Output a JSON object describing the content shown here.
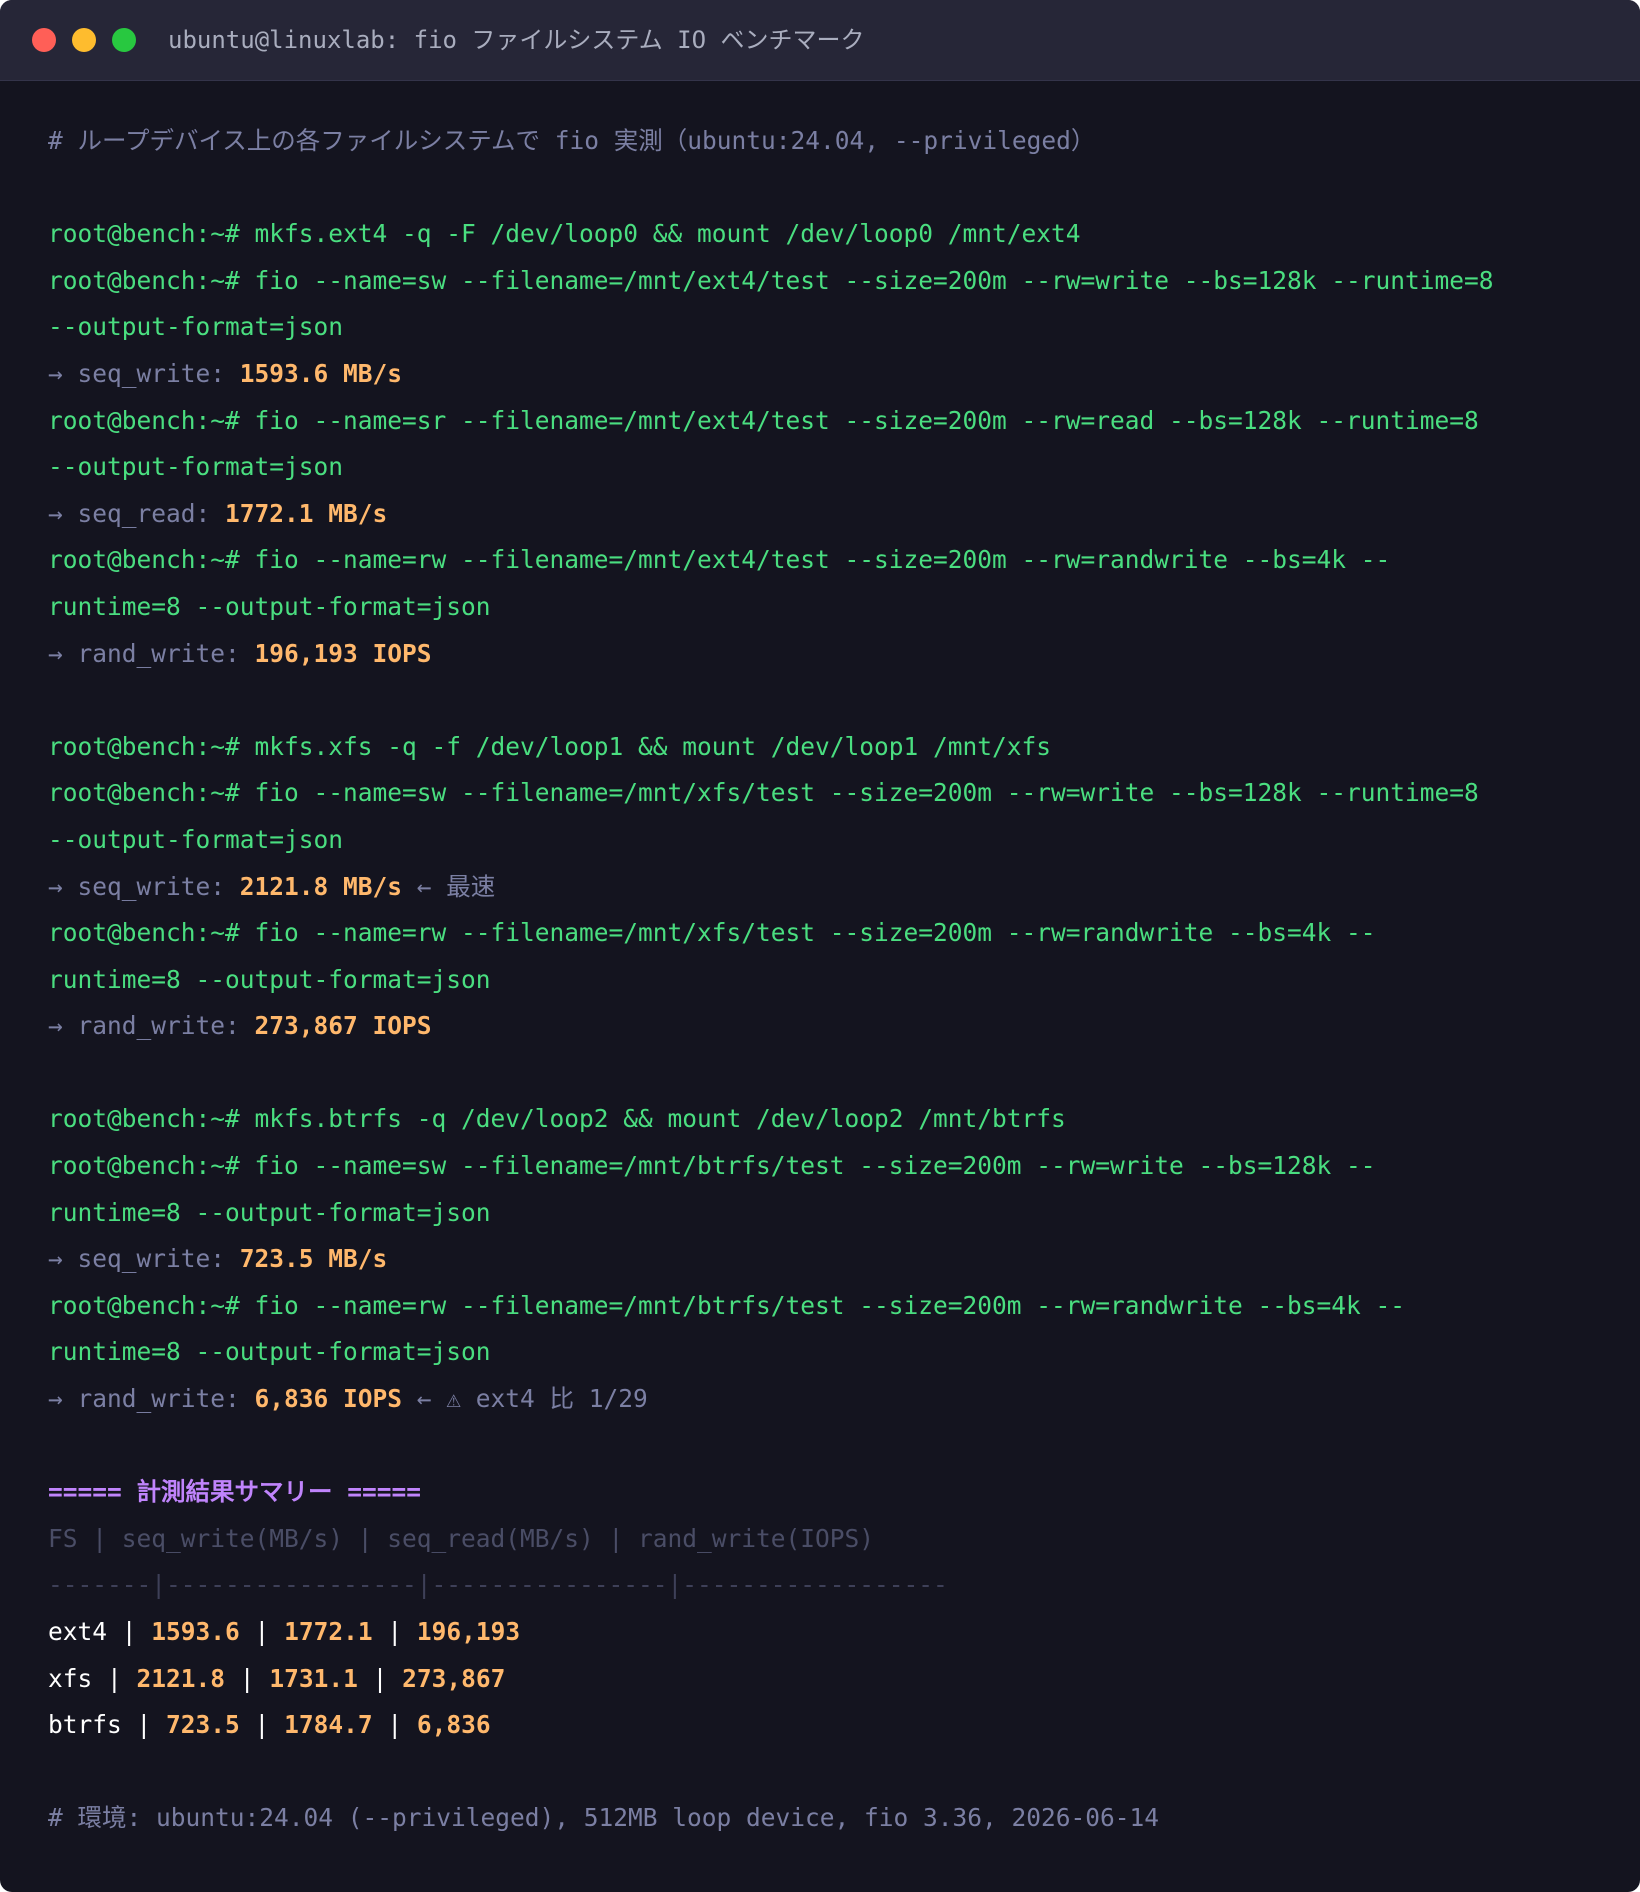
{
  "window": {
    "title": "ubuntu@linuxlab: fio ファイルシステム IO ベンチマーク"
  },
  "colors": {
    "background": "#14141f",
    "command": "#4ade80",
    "value": "#ffb86c",
    "comment": "#7b7fa3",
    "heading": "#c084fc"
  },
  "terminal": {
    "intro_comment": "# ループデバイス上の各ファイルシステムで fio 実測（ubuntu:24.04, --privileged）",
    "ext4": {
      "mkfs": "root@bench:~# mkfs.ext4 -q -F /dev/loop0 && mount /dev/loop0 /mnt/ext4",
      "sw_cmd_1": "root@bench:~# fio --name=sw --filename=/mnt/ext4/test --size=200m --rw=write --bs=128k --runtime=8",
      "sw_cmd_2": "--output-format=json",
      "sw_label": "→ seq_write: ",
      "sw_value": "1593.6 MB/s",
      "sr_cmd_1": "root@bench:~# fio --name=sr --filename=/mnt/ext4/test --size=200m --rw=read --bs=128k --runtime=8",
      "sr_cmd_2": "--output-format=json",
      "sr_label": "→ seq_read: ",
      "sr_value": "1772.1 MB/s",
      "rw_cmd_1": "root@bench:~# fio --name=rw --filename=/mnt/ext4/test --size=200m --rw=randwrite --bs=4k --",
      "rw_cmd_2": "runtime=8 --output-format=json",
      "rw_label": "→ rand_write: ",
      "rw_value": "196,193 IOPS"
    },
    "xfs": {
      "mkfs": "root@bench:~# mkfs.xfs -q -f /dev/loop1 && mount /dev/loop1 /mnt/xfs",
      "sw_cmd_1": "root@bench:~# fio --name=sw --filename=/mnt/xfs/test --size=200m --rw=write --bs=128k --runtime=8",
      "sw_cmd_2": "--output-format=json",
      "sw_label": "→ seq_write: ",
      "sw_value": "2121.8 MB/s",
      "sw_note": " ← 最速",
      "rw_cmd_1": "root@bench:~# fio --name=rw --filename=/mnt/xfs/test --size=200m --rw=randwrite --bs=4k --",
      "rw_cmd_2": "runtime=8 --output-format=json",
      "rw_label": "→ rand_write: ",
      "rw_value": "273,867 IOPS"
    },
    "btrfs": {
      "mkfs": "root@bench:~# mkfs.btrfs -q /dev/loop2 && mount /dev/loop2 /mnt/btrfs",
      "sw_cmd_1": "root@bench:~# fio --name=sw --filename=/mnt/btrfs/test --size=200m --rw=write --bs=128k --",
      "sw_cmd_2": "runtime=8 --output-format=json",
      "sw_label": "→ seq_write: ",
      "sw_value": "723.5 MB/s",
      "rw_cmd_1": "root@bench:~# fio --name=rw --filename=/mnt/btrfs/test --size=200m --rw=randwrite --bs=4k --",
      "rw_cmd_2": "runtime=8 --output-format=json",
      "rw_label": "→ rand_write: ",
      "rw_value": "6,836 IOPS",
      "rw_note": " ← ⚠ ext4 比 1/29"
    },
    "summary": {
      "heading": "===== 計測結果サマリー =====",
      "columns": "FS | seq_write(MB/s) | seq_read(MB/s) | rand_write(IOPS)",
      "separator": "-------|-----------------|----------------|------------------",
      "rows": [
        {
          "fs": "ext4",
          "seq_write": "1593.6",
          "seq_read": "1772.1",
          "rand_write": "196,193"
        },
        {
          "fs": "xfs",
          "seq_write": "2121.8",
          "seq_read": "1731.1",
          "rand_write": "273,867"
        },
        {
          "fs": "btrfs",
          "seq_write": "723.5",
          "seq_read": "1784.7",
          "rand_write": "6,836"
        }
      ]
    },
    "env_comment": "# 環境: ubuntu:24.04 (--privileged), 512MB loop device, fio 3.36, 2026-06-14"
  }
}
